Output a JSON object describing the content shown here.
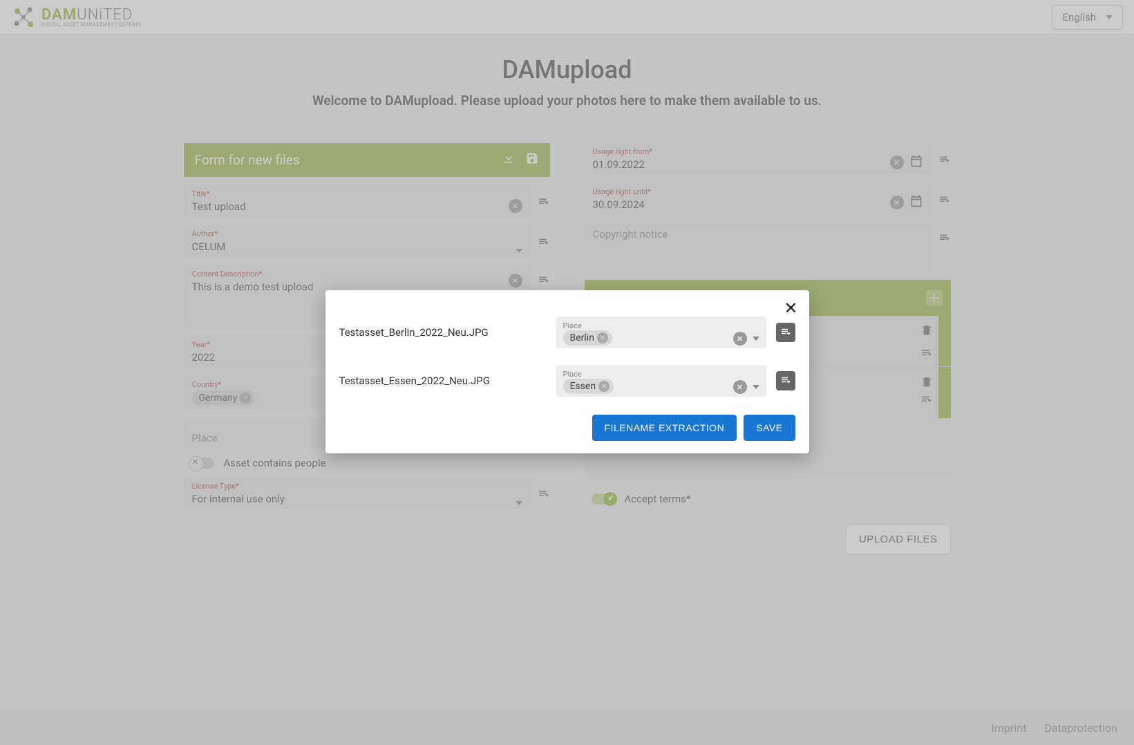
{
  "brand": {
    "name_part1": "DAM",
    "name_part2": "UNiTED",
    "tagline": "DIGITAL ASSET MANAGEMENT EXPERTS"
  },
  "language": {
    "selected": "English"
  },
  "page": {
    "title": "DAMupload",
    "subtitle": "Welcome to DAMupload. Please upload your photos here to make them available to us."
  },
  "form": {
    "header": "Form for new files",
    "title": {
      "label": "Title*",
      "value": "Test upload"
    },
    "author": {
      "label": "Author*",
      "value": "CELUM"
    },
    "description": {
      "label": "Content Description*",
      "value": "This is a demo test upload"
    },
    "year": {
      "label": "Year*",
      "value": "2022"
    },
    "country": {
      "label": "Country*",
      "value": "Germany"
    },
    "place": {
      "label": "Place"
    },
    "contains_people": {
      "label": "Asset contains people"
    },
    "license": {
      "label": "License Type*",
      "value": "For internal use only"
    },
    "usage_from": {
      "label": "Usage right from*",
      "value": "01.09.2022"
    },
    "usage_until": {
      "label": "Usage right until*",
      "value": "30.09.2024"
    },
    "copyright": {
      "label": "Copyright notice"
    },
    "accept_terms": {
      "label": "Accept terms*"
    },
    "upload_button": "UPLOAD FILES"
  },
  "dialog": {
    "rows": [
      {
        "filename": "Testasset_Berlin_2022_Neu.JPG",
        "place_label": "Place",
        "place_value": "Berlin"
      },
      {
        "filename": "Testasset_Essen_2022_Neu.JPG",
        "place_label": "Place",
        "place_value": "Essen"
      }
    ],
    "extract_button": "FILENAME EXTRACTION",
    "save_button": "SAVE"
  },
  "footer": {
    "imprint": "Imprint",
    "dataprotection": "Dataprotection"
  }
}
